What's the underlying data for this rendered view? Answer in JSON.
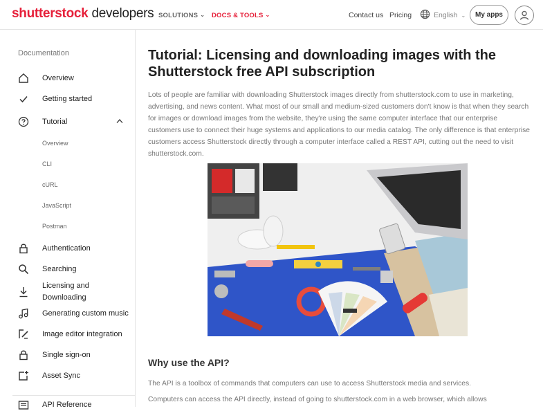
{
  "header": {
    "logo_brand": "shutterstock",
    "logo_suffix": "developers",
    "nav": [
      {
        "label": "SOLUTIONS",
        "active": false
      },
      {
        "label": "DOCS & TOOLS",
        "active": true
      }
    ],
    "contact": "Contact us",
    "pricing": "Pricing",
    "language": "English",
    "my_apps": "My apps",
    "accent_color": "#e6203a"
  },
  "sidebar": {
    "heading": "Documentation",
    "items": [
      {
        "label": "Overview",
        "icon": "home-icon"
      },
      {
        "label": "Getting started",
        "icon": "check-icon"
      },
      {
        "label": "Tutorial",
        "icon": "question-circle-icon",
        "expanded": true
      },
      {
        "label": "Authentication",
        "icon": "lock-icon"
      },
      {
        "label": "Searching",
        "icon": "search-icon"
      },
      {
        "label": "Licensing and",
        "label2": "Downloading",
        "icon": "download-icon"
      },
      {
        "label": "Generating custom music",
        "icon": "music-note-icon"
      },
      {
        "label": "Image editor integration",
        "icon": "image-edit-icon"
      },
      {
        "label": "Single sign-on",
        "icon": "lock-icon"
      },
      {
        "label": "Asset Sync",
        "icon": "asset-sync-icon"
      },
      {
        "label": "API Reference",
        "icon": "api-reference-icon"
      }
    ],
    "tutorial_subitems": [
      "Overview",
      "CLI",
      "cURL",
      "JavaScript",
      "Postman"
    ]
  },
  "article": {
    "title_line1": "Tutorial: Licensing and downloading images with the",
    "title_line2": "Shutterstock free API subscription",
    "intro": "Lots of people are familiar with downloading Shutterstock images directly from shutterstock.com to use in marketing, advertising, and news content. What most of our small and medium-sized customers don't know is that when they search for images or download images from the website, they're using the same computer interface that our enterprise customers use to connect their huge systems and applications to our media catalog. The only difference is that enterprise customers access Shutterstock directly through a computer interface called a REST API, cutting out the need to visit shutterstock.com.",
    "section_heading": "Why use the API?",
    "para1": "The API is a toolbox of commands that computers can use to access Shutterstock media and services.",
    "para2": "Computers can access the API directly, instead of going to shutterstock.com in a web browser, which allows"
  }
}
